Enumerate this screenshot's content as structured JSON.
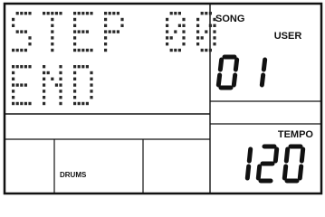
{
  "display": {
    "line1": "STEP 00",
    "line2": "END",
    "song_label": "SONG",
    "song_bank": "USER",
    "song_number": "01",
    "tempo_label": "TEMPO",
    "tempo_value": "120",
    "part_label": "DRUMS"
  },
  "colors": {
    "ink": "#111111",
    "dot": "#2a2a2a",
    "background": "#ffffff"
  }
}
